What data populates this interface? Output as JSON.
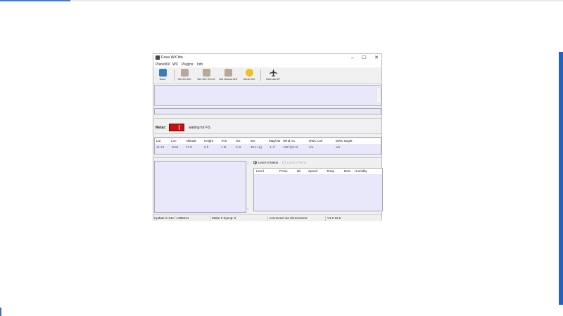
{
  "window": {
    "title": "Fsxa WX lite"
  },
  "menu": [
    "PlaneWX",
    "WX",
    "Plugins",
    "Info"
  ],
  "toolbar": {
    "buttons": [
      {
        "label": "Save",
        "icon": "save-icon",
        "color": "#3a7db8"
      },
      {
        "label": "Set A1 WX",
        "icon": "weather-station-icon",
        "color": "#b8a898"
      },
      {
        "label": "Set WX SCLO",
        "icon": "weather-station-icon",
        "color": "#b8a898"
      },
      {
        "label": "Set Global WX",
        "icon": "weather-station-icon",
        "color": "#b8a898"
      },
      {
        "label": "Clear WX",
        "icon": "sun-cloud-icon",
        "color": "#f0c020"
      },
      {
        "label": "Refresh AT",
        "icon": "airplane-icon",
        "color": "#333333"
      }
    ]
  },
  "metar": {
    "label": "Metar:",
    "status": "waiting for FS",
    "box_color": "#c81010"
  },
  "table": {
    "headers": [
      "Lat",
      "Lon",
      "Altitude",
      "Height",
      "TAS",
      "GS",
      "Wx",
      "Mag/Var",
      "Wind AC",
      "DWC curr",
      "DWC target"
    ],
    "row": [
      "41.24",
      "-8.60",
      "72 ft",
      "6 ft",
      "1 kt",
      "0 kt",
      "30.1 Hg",
      "-1.4°",
      "125°@0 kt",
      "n/a",
      "n/a"
    ]
  },
  "layers": {
    "option_metar": "Level of Metar",
    "option_wind": "Level of Wind",
    "headers": [
      "Level",
      "Press",
      "Dir",
      "Speed",
      "Temp",
      "Dew",
      "Humidity"
    ]
  },
  "status": {
    "update": "Update in 54s / 12MM14",
    "metar_synop": "Metar 0 Synop: 0",
    "connection": "connected via SimConnect",
    "version": "V1.0 15.5"
  },
  "colors": {
    "pane_bg": "#e8e8fa",
    "taskbar_accent": "#1f63c6"
  }
}
